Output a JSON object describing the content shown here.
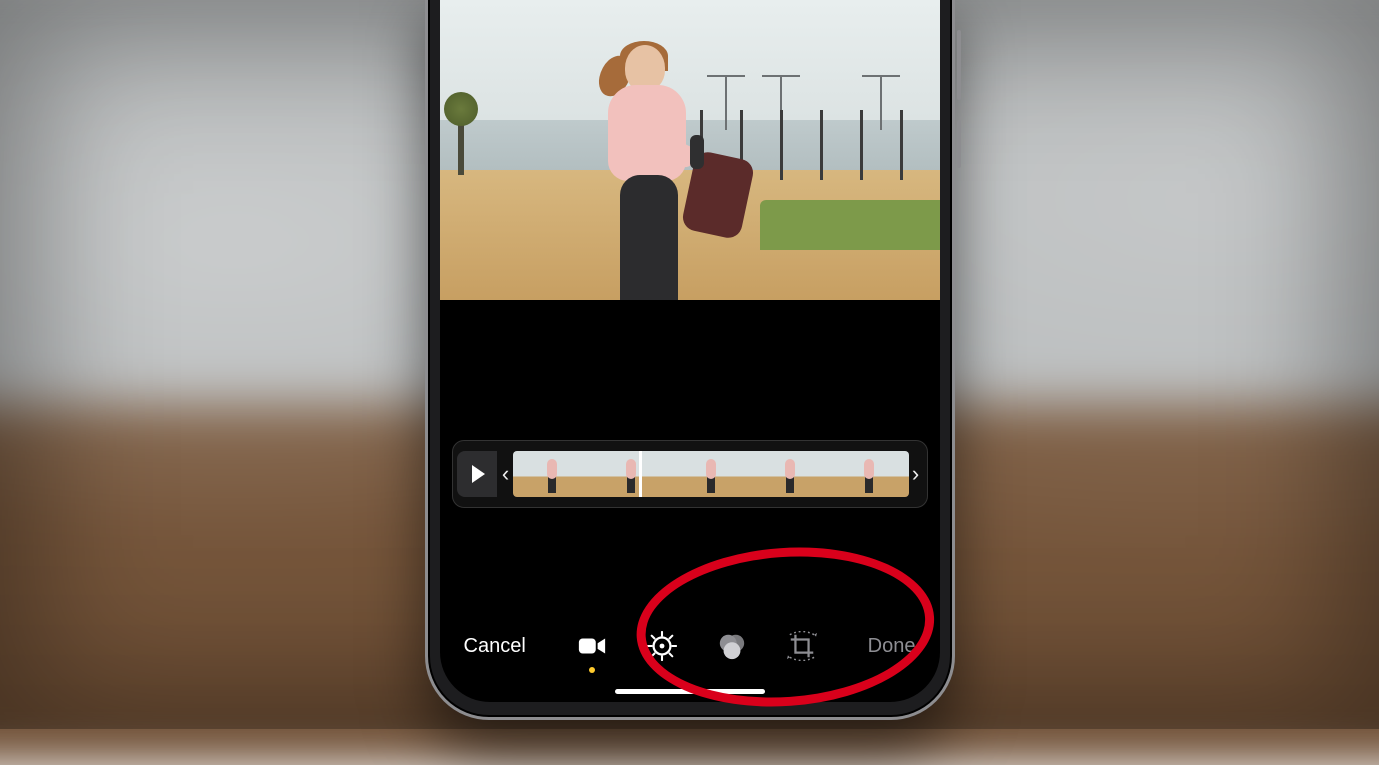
{
  "toolbar": {
    "cancel_label": "Cancel",
    "done_label": "Done",
    "tools": {
      "video": "video-icon",
      "adjust": "adjust-dial-icon",
      "filters": "filters-icon",
      "crop": "crop-rotate-icon"
    },
    "active_tool": "video"
  },
  "timeline": {
    "play_label": "play",
    "trim_start_glyph": "‹",
    "trim_end_glyph": "›",
    "frame_count": 5
  },
  "annotation": {
    "highlight": "filters-and-crop-tools"
  }
}
